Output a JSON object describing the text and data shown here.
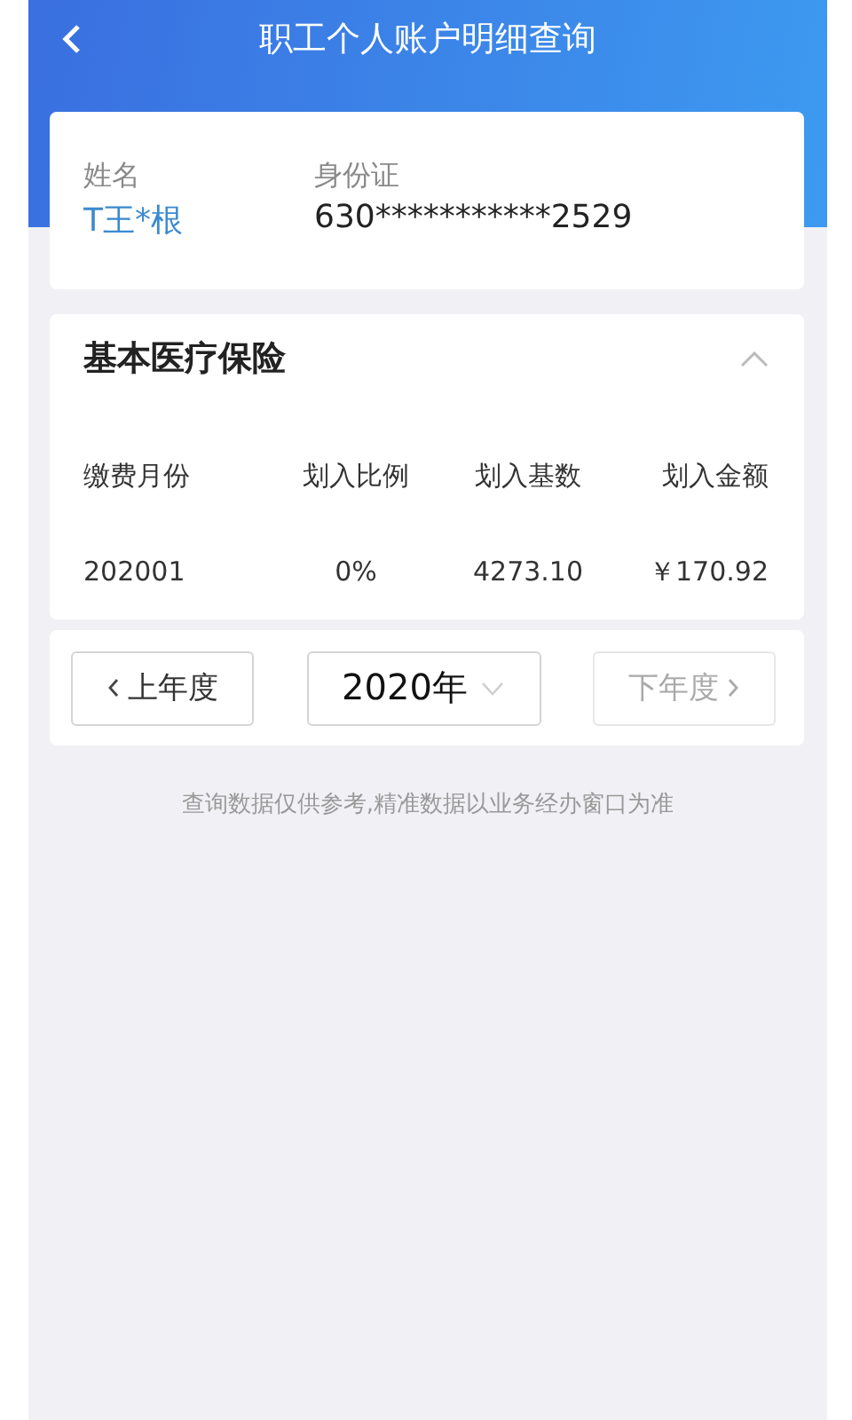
{
  "header": {
    "title": "职工个人账户明细查询"
  },
  "person": {
    "name_label": "姓名",
    "name": "T王*根",
    "id_label": "身份证",
    "id": "630***********2529"
  },
  "section": {
    "title": "基本医疗保险",
    "expanded": true,
    "columns": [
      "缴费月份",
      "划入比例",
      "划入基数",
      "划入金额"
    ],
    "rows": [
      [
        "202001",
        "0%",
        "4273.10",
        "￥170.92"
      ]
    ]
  },
  "year_nav": {
    "prev": {
      "label": "上年度",
      "disabled": false
    },
    "year": "2020年",
    "next": {
      "label": "下年度",
      "disabled": true
    }
  },
  "note": "查询数据仅供参考,精准数据以业务经办窗口为准"
}
